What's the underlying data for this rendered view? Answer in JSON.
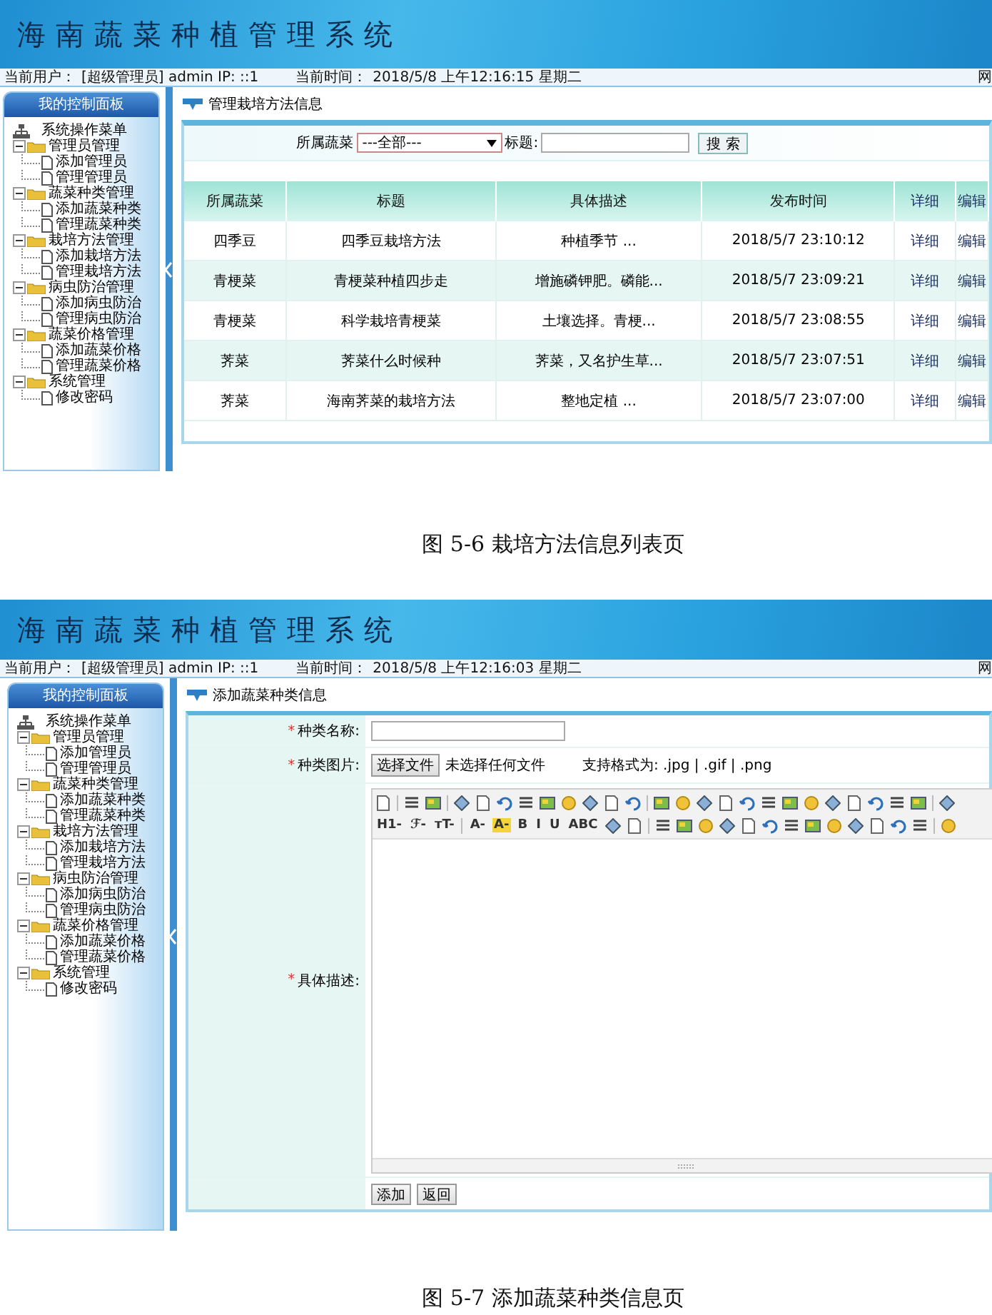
{
  "figures": [
    {
      "screen": {
        "kind": "list",
        "app_title": "海南蔬菜种植管理系统",
        "user_label": "当前用户：",
        "user": "[超级管理员] admin  IP: ::1",
        "time_label": "当前时间：",
        "time": "2018/5/8 上午12:16:15 星期二",
        "edge_text": "网",
        "panel_title": "我的控制面板",
        "menu": {
          "label": "系统操作菜单",
          "children": [
            {
              "label": "管理员管理",
              "expanded": true,
              "children": [
                {
                  "label": "添加管理员"
                },
                {
                  "label": "管理管理员"
                }
              ]
            },
            {
              "label": "蔬菜种类管理",
              "expanded": true,
              "children": [
                {
                  "label": "添加蔬菜种类"
                },
                {
                  "label": "管理蔬菜种类"
                }
              ]
            },
            {
              "label": "栽培方法管理",
              "expanded": true,
              "children": [
                {
                  "label": "添加栽培方法"
                },
                {
                  "label": "管理栽培方法"
                }
              ]
            },
            {
              "label": "病虫防治管理",
              "expanded": true,
              "children": [
                {
                  "label": "添加病虫防治"
                },
                {
                  "label": "管理病虫防治"
                }
              ]
            },
            {
              "label": "蔬菜价格管理",
              "expanded": true,
              "children": [
                {
                  "label": "添加蔬菜价格"
                },
                {
                  "label": "管理蔬菜价格"
                }
              ]
            },
            {
              "label": "系统管理",
              "expanded": true,
              "children": [
                {
                  "label": "修改密码"
                }
              ]
            }
          ]
        },
        "page_title": "管理栽培方法信息",
        "search": {
          "select_label": "所属蔬菜",
          "select_value": "---全部---",
          "title_label": "标题:",
          "button": "搜 索"
        },
        "table": {
          "columns": [
            {
              "label": "所属蔬菜",
              "kind": "text"
            },
            {
              "label": "标题",
              "kind": "text"
            },
            {
              "label": "具体描述",
              "kind": "text"
            },
            {
              "label": "发布时间",
              "kind": "text"
            },
            {
              "label": "详细",
              "kind": "link"
            },
            {
              "label": "编辑",
              "kind": "link"
            }
          ],
          "rows": [
            [
              "四季豆",
              "四季豆栽培方法",
              "种植季节 ...",
              "2018/5/7 23:10:12",
              "详细",
              "编辑"
            ],
            [
              "青梗菜",
              "青梗菜种植四步走",
              "增施磷钾肥。磷能...",
              "2018/5/7 23:09:21",
              "详细",
              "编辑"
            ],
            [
              "青梗菜",
              "科学栽培青梗菜",
              "土壤选择。青梗...",
              "2018/5/7 23:08:55",
              "详细",
              "编辑"
            ],
            [
              "荠菜",
              "荠菜什么时候种",
              "荠菜，又名护生草...",
              "2018/5/7 23:07:51",
              "详细",
              "编辑"
            ],
            [
              "荠菜",
              "海南荠菜的栽培方法",
              "整地定植 ...",
              "2018/5/7 23:07:00",
              "详细",
              "编辑"
            ]
          ]
        }
      },
      "caption": "图 5-6 栽培方法信息列表页"
    },
    {
      "screen": {
        "kind": "form",
        "app_title": "海南蔬菜种植管理系统",
        "user_label": "当前用户：",
        "user": "[超级管理员] admin  IP: ::1",
        "time_label": "当前时间：",
        "time": "2018/5/8 上午12:16:03 星期二",
        "edge_text": "网",
        "panel_title": "我的控制面板",
        "menu": {
          "label": "系统操作菜单",
          "children": [
            {
              "label": "管理员管理",
              "expanded": true,
              "children": [
                {
                  "label": "添加管理员"
                },
                {
                  "label": "管理管理员"
                }
              ]
            },
            {
              "label": "蔬菜种类管理",
              "expanded": true,
              "children": [
                {
                  "label": "添加蔬菜种类"
                },
                {
                  "label": "管理蔬菜种类"
                }
              ]
            },
            {
              "label": "栽培方法管理",
              "expanded": true,
              "children": [
                {
                  "label": "添加栽培方法"
                },
                {
                  "label": "管理栽培方法"
                }
              ]
            },
            {
              "label": "病虫防治管理",
              "expanded": true,
              "children": [
                {
                  "label": "添加病虫防治"
                },
                {
                  "label": "管理病虫防治"
                }
              ]
            },
            {
              "label": "蔬菜价格管理",
              "expanded": true,
              "children": [
                {
                  "label": "添加蔬菜价格"
                },
                {
                  "label": "管理蔬菜价格"
                }
              ]
            },
            {
              "label": "系统管理",
              "expanded": true,
              "children": [
                {
                  "label": "修改密码"
                }
              ]
            }
          ]
        },
        "page_title": "添加蔬菜种类信息",
        "fields": [
          {
            "kind": "text",
            "mark": "*",
            "label": "种类名称:"
          },
          {
            "kind": "file",
            "mark": "*",
            "label": "种类图片:",
            "button": "选择文件",
            "status": "未选择任何文件",
            "hint": "支持格式为: .jpg | .gif | .png"
          },
          {
            "kind": "editor",
            "mark": "*",
            "label": "具体描述:",
            "toolbar": [
              [
                {
                  "kind": "icon"
                },
                {
                  "kind": "sep"
                },
                {
                  "kind": "icon"
                },
                {
                  "kind": "icon"
                },
                {
                  "kind": "sep"
                },
                {
                  "kind": "icon"
                },
                {
                  "kind": "icon"
                },
                {
                  "kind": "icon"
                },
                {
                  "kind": "icon"
                },
                {
                  "kind": "icon"
                },
                {
                  "kind": "icon"
                },
                {
                  "kind": "icon"
                },
                {
                  "kind": "icon"
                },
                {
                  "kind": "icon"
                },
                {
                  "kind": "sep"
                },
                {
                  "kind": "icon"
                },
                {
                  "kind": "icon"
                },
                {
                  "kind": "icon"
                },
                {
                  "kind": "icon"
                },
                {
                  "kind": "icon"
                },
                {
                  "kind": "icon"
                },
                {
                  "kind": "icon"
                },
                {
                  "kind": "icon"
                },
                {
                  "kind": "icon"
                },
                {
                  "kind": "icon"
                },
                {
                  "kind": "icon"
                },
                {
                  "kind": "icon"
                },
                {
                  "kind": "icon"
                },
                {
                  "kind": "sep"
                },
                {
                  "kind": "icon"
                }
              ],
              [
                {
                  "kind": "text",
                  "label": "H1-"
                },
                {
                  "kind": "text",
                  "label": "ℱ-"
                },
                {
                  "kind": "text",
                  "label": "тT-"
                },
                {
                  "kind": "sep"
                },
                {
                  "kind": "text",
                  "label": "A-"
                },
                {
                  "kind": "highlight",
                  "label": "A-"
                },
                {
                  "kind": "text",
                  "label": "B"
                },
                {
                  "kind": "text",
                  "label": "I"
                },
                {
                  "kind": "text",
                  "label": "U"
                },
                {
                  "kind": "text",
                  "label": "ABC"
                },
                {
                  "kind": "icon"
                },
                {
                  "kind": "icon"
                },
                {
                  "kind": "sep"
                },
                {
                  "kind": "icon"
                },
                {
                  "kind": "icon"
                },
                {
                  "kind": "icon"
                },
                {
                  "kind": "icon"
                },
                {
                  "kind": "icon"
                },
                {
                  "kind": "icon"
                },
                {
                  "kind": "icon"
                },
                {
                  "kind": "icon"
                },
                {
                  "kind": "icon"
                },
                {
                  "kind": "icon"
                },
                {
                  "kind": "icon"
                },
                {
                  "kind": "icon"
                },
                {
                  "kind": "icon"
                },
                {
                  "kind": "sep"
                },
                {
                  "kind": "icon"
                }
              ]
            ]
          }
        ],
        "buttons": [
          "添加",
          "返回"
        ]
      },
      "caption": "图 5-7 添加蔬菜种类信息页"
    }
  ]
}
